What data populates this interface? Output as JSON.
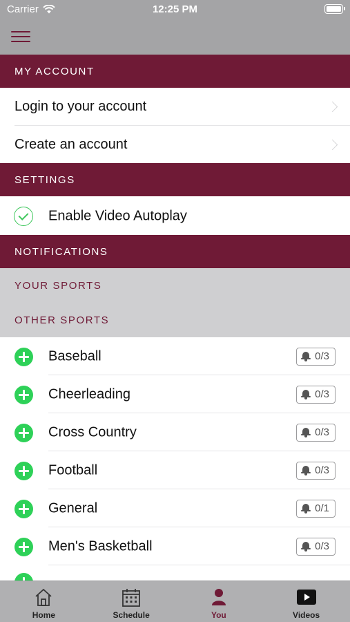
{
  "status_bar": {
    "carrier": "Carrier",
    "time": "12:25 PM"
  },
  "colors": {
    "brand": "#6f1a36",
    "accent_green": "#2ed158",
    "bar_gray": "#a4a4a6",
    "subheader_gray": "#cfcfd1"
  },
  "sections": {
    "my_account": "MY ACCOUNT",
    "settings": "SETTINGS",
    "notifications": "NOTIFICATIONS",
    "your_sports": "YOUR SPORTS",
    "other_sports": "OTHER SPORTS"
  },
  "account": {
    "login": "Login to your account",
    "create": "Create an account"
  },
  "settings": {
    "autoplay_label": "Enable Video Autoplay",
    "autoplay_enabled": true
  },
  "sports": [
    {
      "name": "Baseball",
      "count": "0/3"
    },
    {
      "name": "Cheerleading",
      "count": "0/3"
    },
    {
      "name": "Cross Country",
      "count": "0/3"
    },
    {
      "name": "Football",
      "count": "0/3"
    },
    {
      "name": "General",
      "count": "0/1"
    },
    {
      "name": "Men's Basketball",
      "count": "0/3"
    }
  ],
  "tabs": [
    {
      "label": "Home",
      "icon": "home-icon"
    },
    {
      "label": "Schedule",
      "icon": "calendar-icon"
    },
    {
      "label": "You",
      "icon": "person-icon",
      "active": true
    },
    {
      "label": "Videos",
      "icon": "play-icon"
    }
  ]
}
